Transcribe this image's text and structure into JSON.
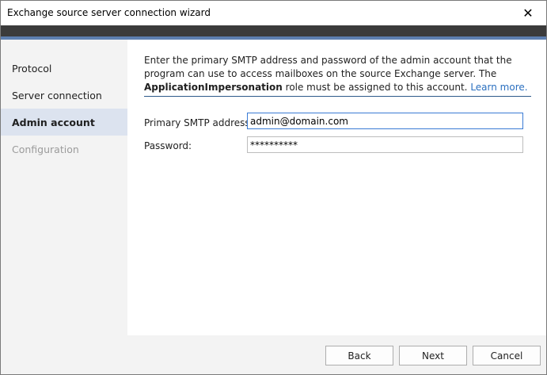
{
  "window": {
    "title": "Exchange source server connection wizard",
    "close_glyph": "✕"
  },
  "sidebar": {
    "items": [
      {
        "label": "Protocol",
        "state": "normal"
      },
      {
        "label": "Server connection",
        "state": "normal"
      },
      {
        "label": "Admin account",
        "state": "active"
      },
      {
        "label": "Configuration",
        "state": "disabled"
      }
    ]
  },
  "content": {
    "intro_part1": "Enter the primary SMTP address and password of the admin account that the program can use to access mailboxes on the source Exchange server. The ",
    "intro_bold": "ApplicationImpersonation",
    "intro_part2": " role must be assigned to this account. ",
    "learn_more": "Learn more.",
    "fields": {
      "smtp_label": "Primary SMTP address:",
      "smtp_value": "admin@domain.com",
      "password_label": "Password:",
      "password_value": "**********"
    }
  },
  "footer": {
    "back_label": "Back",
    "next_label": "Next",
    "cancel_label": "Cancel"
  },
  "colors": {
    "accent_stripe": "#5d7fb0",
    "active_nav_bg": "#dce3ef",
    "link": "#2a6fbf"
  }
}
